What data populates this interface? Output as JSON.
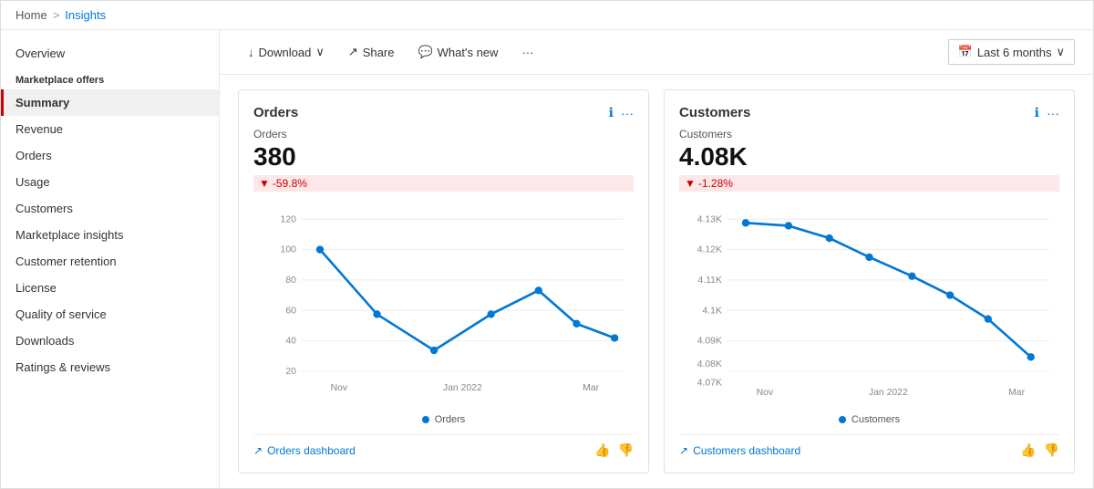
{
  "breadcrumb": {
    "home": "Home",
    "separator": ">",
    "current": "Insights"
  },
  "sidebar": {
    "overview": "Overview",
    "section_label": "Marketplace offers",
    "items": [
      {
        "id": "summary",
        "label": "Summary",
        "active": true
      },
      {
        "id": "revenue",
        "label": "Revenue",
        "active": false
      },
      {
        "id": "orders",
        "label": "Orders",
        "active": false
      },
      {
        "id": "usage",
        "label": "Usage",
        "active": false
      },
      {
        "id": "customers",
        "label": "Customers",
        "active": false
      },
      {
        "id": "marketplace-insights",
        "label": "Marketplace insights",
        "active": false
      },
      {
        "id": "customer-retention",
        "label": "Customer retention",
        "active": false
      },
      {
        "id": "license",
        "label": "License",
        "active": false
      },
      {
        "id": "quality-of-service",
        "label": "Quality of service",
        "active": false
      },
      {
        "id": "downloads",
        "label": "Downloads",
        "active": false
      },
      {
        "id": "ratings-reviews",
        "label": "Ratings & reviews",
        "active": false
      }
    ]
  },
  "toolbar": {
    "download_label": "Download",
    "share_label": "Share",
    "whats_new_label": "What's new",
    "more_label": "...",
    "date_range_label": "Last 6 months"
  },
  "cards": [
    {
      "id": "orders",
      "title": "Orders",
      "metric_label": "Orders",
      "metric_value": "380",
      "metric_change": "-59.8%",
      "dashboard_link": "Orders dashboard",
      "legend_label": "Orders",
      "chart": {
        "x_labels": [
          "Nov",
          "Jan 2022",
          "Mar"
        ],
        "y_labels": [
          "20",
          "40",
          "60",
          "80",
          "100",
          "120"
        ],
        "points": [
          {
            "x": 0.05,
            "y": 0.12
          },
          {
            "x": 0.22,
            "y": 0.53
          },
          {
            "x": 0.35,
            "y": 0.78
          },
          {
            "x": 0.48,
            "y": 0.55
          },
          {
            "x": 0.65,
            "y": 0.38
          },
          {
            "x": 0.8,
            "y": 0.6
          },
          {
            "x": 0.92,
            "y": 0.72
          }
        ]
      }
    },
    {
      "id": "customers",
      "title": "Customers",
      "metric_label": "Customers",
      "metric_value": "4.08K",
      "metric_change": "-1.28%",
      "dashboard_link": "Customers dashboard",
      "legend_label": "Customers",
      "chart": {
        "x_labels": [
          "Nov",
          "Jan 2022",
          "Mar"
        ],
        "y_labels": [
          "4.07K",
          "4.08K",
          "4.09K",
          "4.1K",
          "4.11K",
          "4.12K",
          "4.13K"
        ],
        "points": [
          {
            "x": 0.04,
            "y": 0.08
          },
          {
            "x": 0.17,
            "y": 0.1
          },
          {
            "x": 0.3,
            "y": 0.22
          },
          {
            "x": 0.45,
            "y": 0.38
          },
          {
            "x": 0.6,
            "y": 0.5
          },
          {
            "x": 0.72,
            "y": 0.65
          },
          {
            "x": 0.83,
            "y": 0.78
          },
          {
            "x": 0.93,
            "y": 0.92
          }
        ]
      }
    }
  ],
  "icons": {
    "download": "↓",
    "share": "↗",
    "whats_new": "💬",
    "chevron_down": "∨",
    "calendar": "📅",
    "info": "ℹ",
    "more": "···",
    "trend": "↗",
    "thumbup": "👍",
    "thumbdown": "👎"
  }
}
